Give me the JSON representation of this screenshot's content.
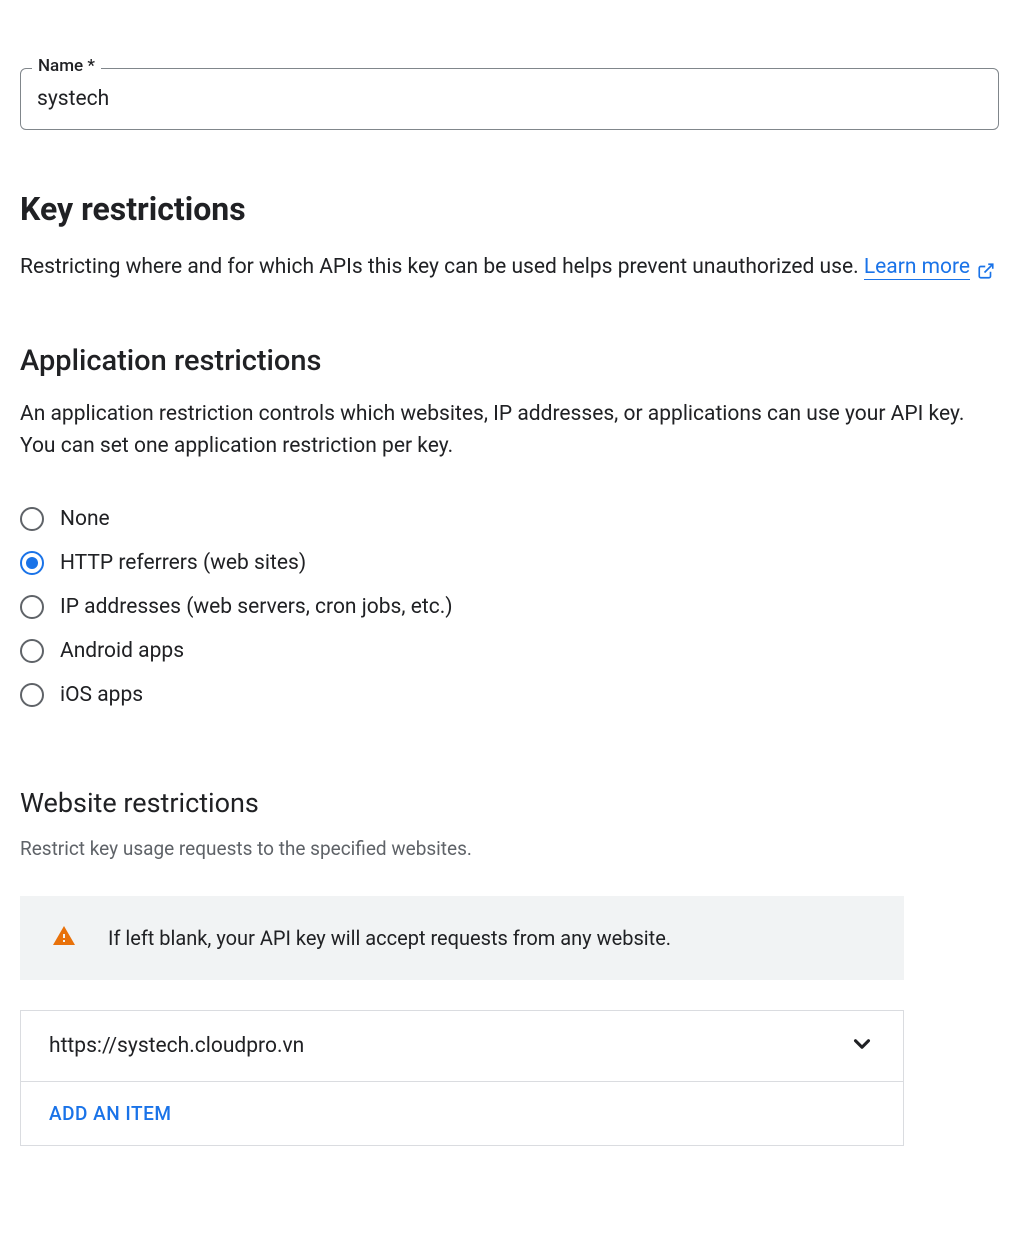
{
  "name_field": {
    "label": "Name *",
    "value": "systech"
  },
  "key_restrictions": {
    "heading": "Key restrictions",
    "description": "Restricting where and for which APIs this key can be used helps prevent unauthorized use. ",
    "learn_more": "Learn more"
  },
  "app_restrictions": {
    "heading": "Application restrictions",
    "description": "An application restriction controls which websites, IP addresses, or applications can use your API key. You can set one application restriction per key.",
    "options": [
      {
        "label": "None",
        "selected": false
      },
      {
        "label": "HTTP referrers (web sites)",
        "selected": true
      },
      {
        "label": "IP addresses (web servers, cron jobs, etc.)",
        "selected": false
      },
      {
        "label": "Android apps",
        "selected": false
      },
      {
        "label": "iOS apps",
        "selected": false
      }
    ]
  },
  "website_restrictions": {
    "heading": "Website restrictions",
    "description": "Restrict key usage requests to the specified websites.",
    "warning": "If left blank, your API key will accept requests from any website.",
    "items": [
      {
        "url": "https://systech.cloudpro.vn"
      }
    ],
    "add_label": "ADD AN ITEM"
  }
}
